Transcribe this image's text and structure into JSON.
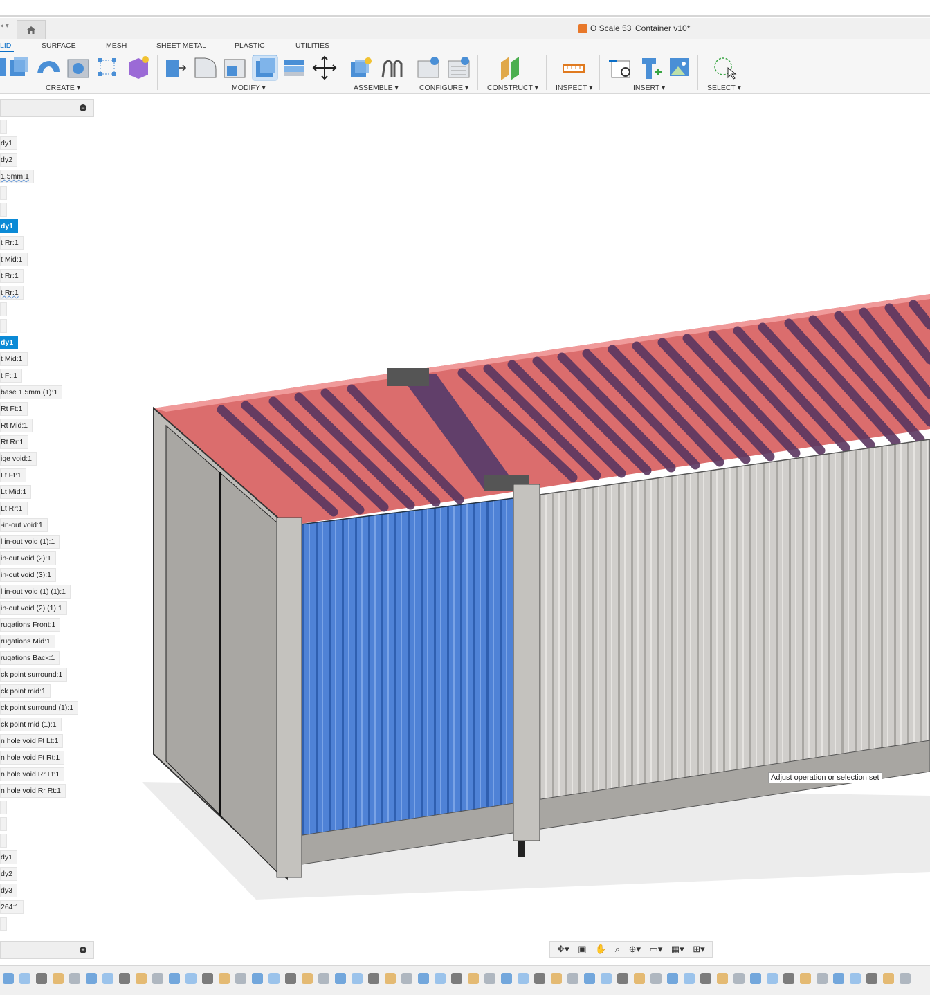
{
  "app": {
    "document_title": "O Scale 53' Container v10*"
  },
  "ribbon": {
    "tabs": [
      {
        "label": "LID",
        "active": true
      },
      {
        "label": "SURFACE"
      },
      {
        "label": "MESH"
      },
      {
        "label": "SHEET METAL"
      },
      {
        "label": "PLASTIC"
      },
      {
        "label": "UTILITIES"
      }
    ],
    "groups": [
      {
        "label": "CREATE ▾"
      },
      {
        "label": "MODIFY ▾"
      },
      {
        "label": "ASSEMBLE ▾"
      },
      {
        "label": "CONFIGURE ▾"
      },
      {
        "label": "CONSTRUCT ▾"
      },
      {
        "label": "INSPECT ▾"
      },
      {
        "label": "INSERT ▾"
      },
      {
        "label": "SELECT ▾"
      }
    ]
  },
  "browser": {
    "collapse_glyph": "−",
    "expand_glyph": "+",
    "nodes": [
      {
        "label": ""
      },
      {
        "label": "dy1"
      },
      {
        "label": "dy2"
      },
      {
        "label": "1.5mm:1",
        "dashed": true
      },
      {
        "label": ""
      },
      {
        "label": ""
      },
      {
        "label": "dy1",
        "highlight": true
      },
      {
        "label": "t Rr:1"
      },
      {
        "label": "t Mid:1"
      },
      {
        "label": "t Rr:1"
      },
      {
        "label": "t Rr:1",
        "dashed": true
      },
      {
        "label": ""
      },
      {
        "label": ""
      },
      {
        "label": "dy1",
        "highlight": true
      },
      {
        "label": "t Mid:1"
      },
      {
        "label": "t Ft:1"
      },
      {
        "label": "base 1.5mm (1):1"
      },
      {
        "label": "Rt Ft:1"
      },
      {
        "label": "Rt Mid:1"
      },
      {
        "label": "Rt Rr:1"
      },
      {
        "label": "ige void:1"
      },
      {
        "label": "Lt Ft:1"
      },
      {
        "label": "Lt Mid:1"
      },
      {
        "label": "Lt Rr:1"
      },
      {
        "label": "-in-out void:1"
      },
      {
        "label": "l in-out void (1):1"
      },
      {
        "label": "in-out void (2):1"
      },
      {
        "label": "in-out void (3):1"
      },
      {
        "label": "l in-out void (1) (1):1"
      },
      {
        "label": "in-out void (2) (1):1"
      },
      {
        "label": "rugations Front:1"
      },
      {
        "label": "rugations Mid:1"
      },
      {
        "label": "rugations Back:1"
      },
      {
        "label": "ck point surround:1"
      },
      {
        "label": "ck point mid:1"
      },
      {
        "label": "ck point surround (1):1"
      },
      {
        "label": "ck point mid (1):1"
      },
      {
        "label": "n hole void Ft Lt:1"
      },
      {
        "label": "n hole void Ft Rt:1"
      },
      {
        "label": "n hole void Rr Lt:1"
      },
      {
        "label": "n hole void Rr Rt:1"
      },
      {
        "label": ""
      },
      {
        "label": ""
      },
      {
        "label": ""
      },
      {
        "label": "dy1"
      },
      {
        "label": "dy2"
      },
      {
        "label": "dy3"
      },
      {
        "label": "264:1"
      },
      {
        "label": ""
      }
    ]
  },
  "viewport": {
    "tooltip": "Adjust operation or selection set"
  },
  "navbar": {
    "icons": [
      "orbit-icon",
      "look-at-icon",
      "pan-icon",
      "zoom-icon",
      "fit-icon",
      "display-mode-icon",
      "grid-icon",
      "viewports-icon"
    ]
  },
  "colors": {
    "accent": "#0a6ec7",
    "highlight_node": "#0b8ad6",
    "selected_side": "#4d7fd4",
    "roof_red": "#d96565",
    "container_grey": "#c9c7c3"
  }
}
